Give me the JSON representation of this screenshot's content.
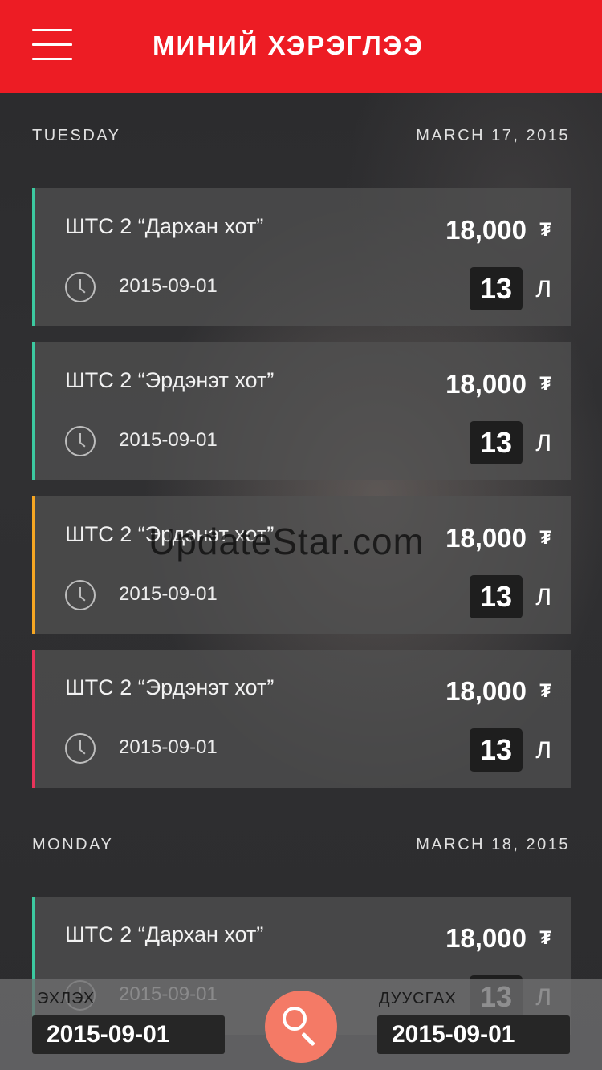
{
  "header": {
    "title": "МИНИЙ ХЭРЭГЛЭЭ",
    "menu_icon": "hamburger-icon",
    "color": "#ed1c24"
  },
  "days": [
    {
      "day": "TUESDAY",
      "date": "MARCH 17, 2015",
      "transactions": [
        {
          "station": "ШТС 2 “Дархан хот”",
          "date": "2015-09-01",
          "price": "18,000",
          "currency": "₮",
          "litres": "13",
          "unit": "Л",
          "accent": "#3cc9a0"
        },
        {
          "station": "ШТС 2 “Эрдэнэт хот”",
          "date": "2015-09-01",
          "price": "18,000",
          "currency": "₮",
          "litres": "13",
          "unit": "Л",
          "accent": "#3cc9a0"
        },
        {
          "station": "ШТС 2 “Эрдэнэт хот”",
          "date": "2015-09-01",
          "price": "18,000",
          "currency": "₮",
          "litres": "13",
          "unit": "Л",
          "accent": "#f5a623"
        },
        {
          "station": "ШТС 2 “Эрдэнэт хот”",
          "date": "2015-09-01",
          "price": "18,000",
          "currency": "₮",
          "litres": "13",
          "unit": "Л",
          "accent": "#e8335a"
        }
      ]
    },
    {
      "day": "MONDAY",
      "date": "MARCH 18, 2015",
      "transactions": [
        {
          "station": "ШТС 2 “Дархан хот”",
          "date": "2015-09-01",
          "price": "18,000",
          "currency": "₮",
          "litres": "13",
          "unit": "Л",
          "accent": "#3cc9a0"
        }
      ]
    }
  ],
  "filter": {
    "start_label": "ЭХЛЭХ",
    "start_value": "2015-09-01",
    "end_label": "ДУУСГАХ",
    "end_value": "2015-09-01",
    "search_icon": "search-icon",
    "search_color": "#f47a66"
  },
  "watermark": "UpdateStar.com"
}
